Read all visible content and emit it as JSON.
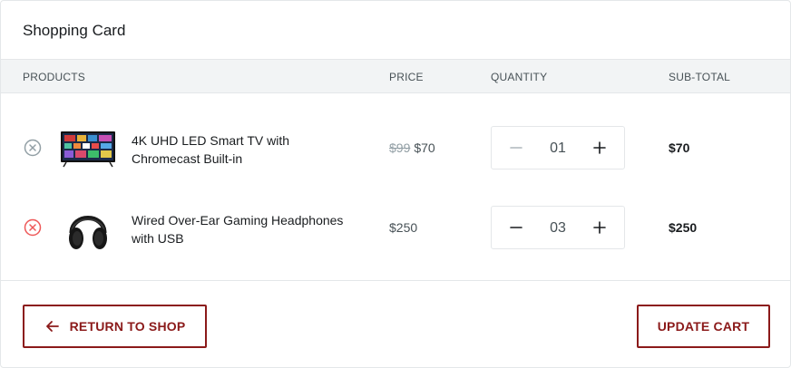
{
  "cart": {
    "title": "Shopping Card",
    "columns": {
      "products": "PRODUCTS",
      "price": "PRICE",
      "quantity": "QUANTITY",
      "subtotal": "SUB-TOTAL"
    },
    "items": [
      {
        "name_line1": "4K UHD LED Smart TV with",
        "name_line2": "Chromecast Built-in",
        "old_price": "$99",
        "price": "$70",
        "quantity": "01",
        "subtotal": "$70",
        "thumb_icon": "tv-icon",
        "remove_color": "#929fa5"
      },
      {
        "name_line1": "Wired Over-Ear Gaming Headphones",
        "name_line2": "with USB",
        "old_price": "",
        "price": "$250",
        "quantity": "03",
        "subtotal": "$250",
        "thumb_icon": "headphones-icon",
        "remove_color": "#ee5858"
      }
    ]
  },
  "footer": {
    "return_label": "RETURN TO SHOP",
    "update_label": "UPDATE CART"
  },
  "colors": {
    "accent": "#8b1a1a",
    "header_bg": "#f2f4f5",
    "border": "#e4e7e9",
    "remove_active": "#ee5858"
  }
}
